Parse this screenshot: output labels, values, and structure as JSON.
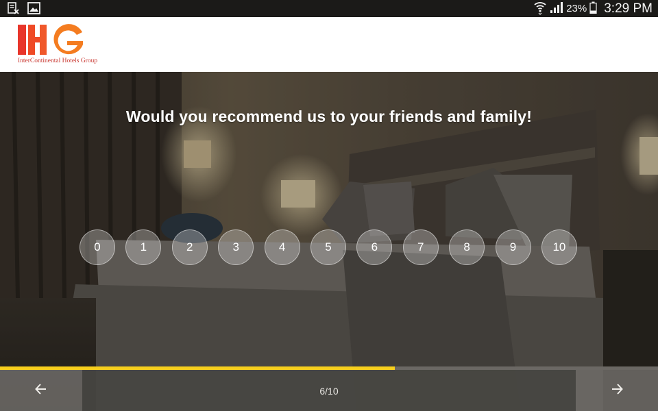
{
  "status_bar": {
    "left_icons": [
      "screenshot-doc-icon",
      "image-icon"
    ],
    "right_icons": [
      "wifi-icon",
      "signal-icon",
      "battery-icon"
    ],
    "battery_percent": "23%",
    "time": "3:29 PM"
  },
  "brand": {
    "logo_letters": "IHG",
    "tagline": "InterContinental Hotels Group",
    "colors": {
      "i": "#e8362b",
      "h": "#ef5c22",
      "g": "#f47c20",
      "tagline": "#c8342d"
    }
  },
  "survey": {
    "question": "Would you recommend us to your friends and family!",
    "ratings": [
      "0",
      "1",
      "2",
      "3",
      "4",
      "5",
      "6",
      "7",
      "8",
      "9",
      "10"
    ]
  },
  "progress": {
    "value": 0.6,
    "fill_color": "#f7cf1d"
  },
  "navigation": {
    "prev_icon": "arrow-left-icon",
    "next_icon": "arrow-right-icon",
    "page_indicator": "6/10"
  }
}
